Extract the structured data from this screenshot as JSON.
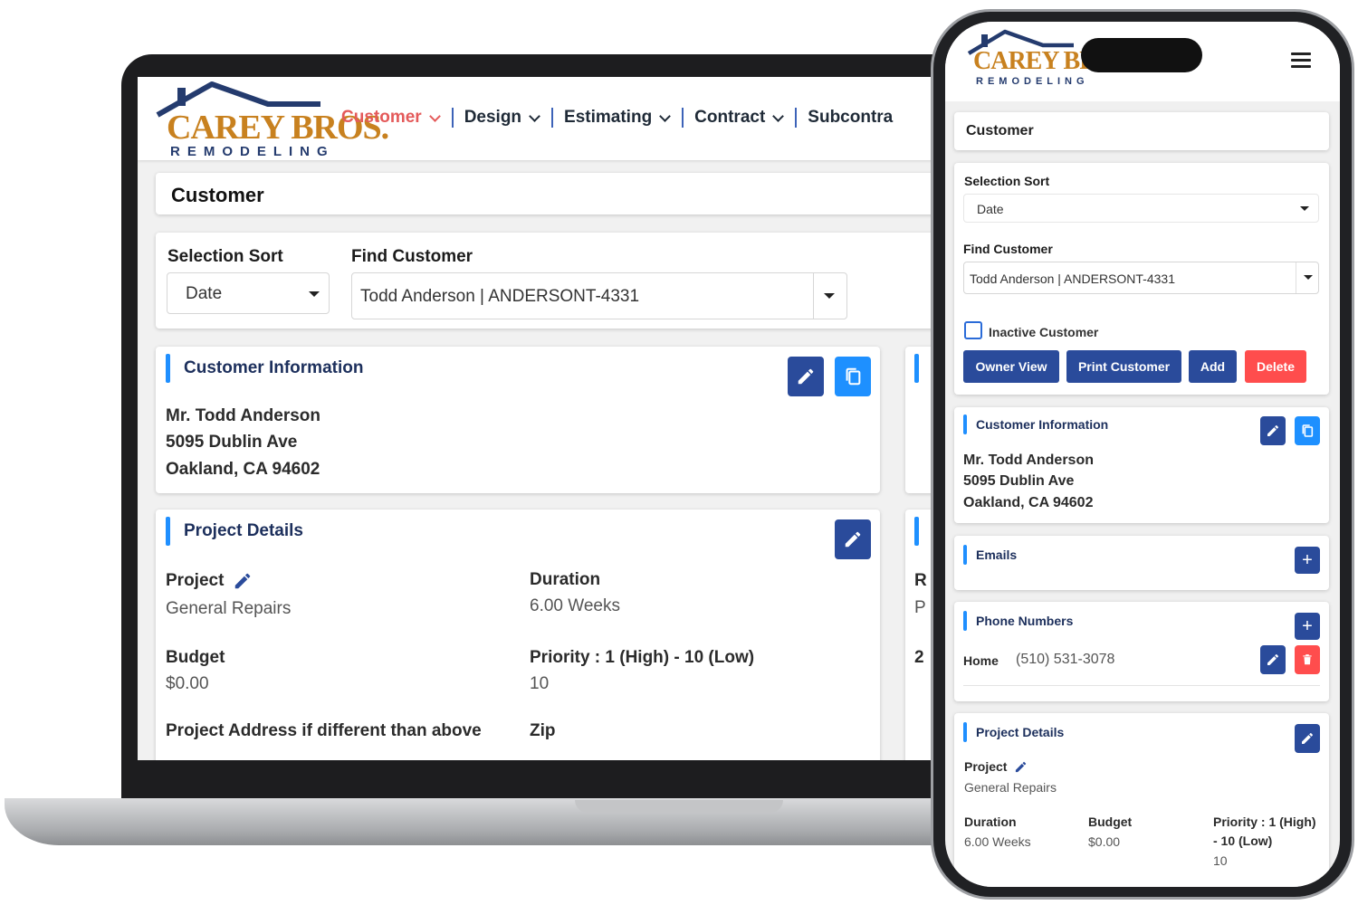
{
  "colors": {
    "accent": "#1e90ff",
    "navy": "#2a4b9b",
    "danger": "#ff4d4d",
    "nav_active": "#e45a5a",
    "brand_gold": "#c8811f",
    "brand_navy": "#243b6e"
  },
  "brand": {
    "name": "CAREY BROS.",
    "tagline": "REMODELING"
  },
  "nav": {
    "items": [
      {
        "label": "Customer",
        "active": true
      },
      {
        "label": "Design"
      },
      {
        "label": "Estimating"
      },
      {
        "label": "Contract"
      },
      {
        "label": "Subcontra"
      }
    ]
  },
  "page": {
    "title": "Customer"
  },
  "filters": {
    "selection_sort_label": "Selection Sort",
    "selection_sort_value": "Date",
    "find_customer_label": "Find Customer",
    "find_customer_value": "Todd Anderson | ANDERSONT-4331"
  },
  "customer_info": {
    "heading": "Customer Information",
    "name": "Mr. Todd Anderson",
    "street": "5095 Dublin Ave",
    "city": "Oakland, CA 94602"
  },
  "project": {
    "heading": "Project Details",
    "project_label": "Project",
    "project_value": "General Repairs",
    "duration_label": "Duration",
    "duration_value": "6.00 Weeks",
    "budget_label": "Budget",
    "budget_value": "$0.00",
    "priority_label": "Priority : 1 (High) - 10 (Low)",
    "priority_label_line1": "Priority : 1 (High)",
    "priority_label_line2": "- 10 (Low)",
    "priority_value": "10",
    "address_label": "Project Address if different than above",
    "zip_label": "Zip"
  },
  "peek": {
    "r": "R",
    "p": "P",
    "two": "2"
  },
  "mobile": {
    "inactive_label": "Inactive Customer",
    "inactive_checked": false,
    "buttons": {
      "owner_view": "Owner View",
      "print_customer": "Print Customer",
      "add": "Add",
      "delete": "Delete"
    },
    "emails_heading": "Emails",
    "phones_heading": "Phone Numbers",
    "phone": {
      "type": "Home",
      "number": "(510) 531-3078"
    }
  }
}
